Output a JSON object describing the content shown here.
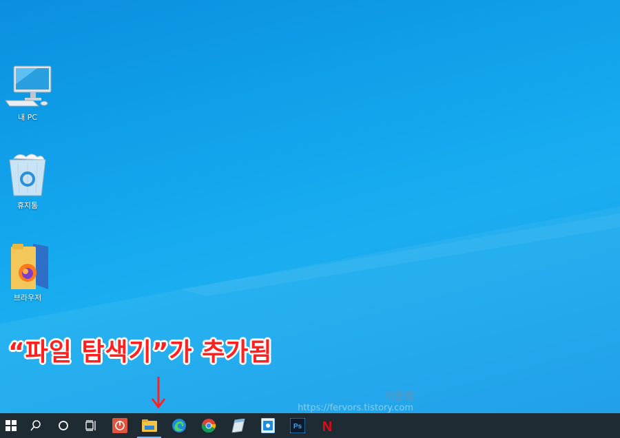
{
  "desktop": {
    "icons": [
      {
        "label": "내 PC",
        "icon": "computer-icon"
      },
      {
        "label": "휴지통",
        "icon": "recycle-bin-icon"
      },
      {
        "label": "브라우저",
        "icon": "browser-folder-icon"
      }
    ]
  },
  "annotation": {
    "text": "“파일 탐색기”가 추가됨",
    "color": "#ff2020"
  },
  "watermark": {
    "name": "쉬운쌤",
    "url": "https://fervors.tistory.com"
  },
  "taskbar": {
    "items": [
      {
        "icon": "windows-start-icon"
      },
      {
        "icon": "search-icon"
      },
      {
        "icon": "cortana-icon"
      },
      {
        "icon": "task-view-icon"
      },
      {
        "icon": "power-app-icon"
      },
      {
        "icon": "file-explorer-icon"
      },
      {
        "icon": "edge-icon"
      },
      {
        "icon": "chrome-icon"
      },
      {
        "icon": "notepad-app-icon"
      },
      {
        "icon": "control-app-icon"
      },
      {
        "icon": "photoshop-icon",
        "text": "Ps"
      },
      {
        "icon": "netflix-icon",
        "text": "N"
      }
    ]
  }
}
